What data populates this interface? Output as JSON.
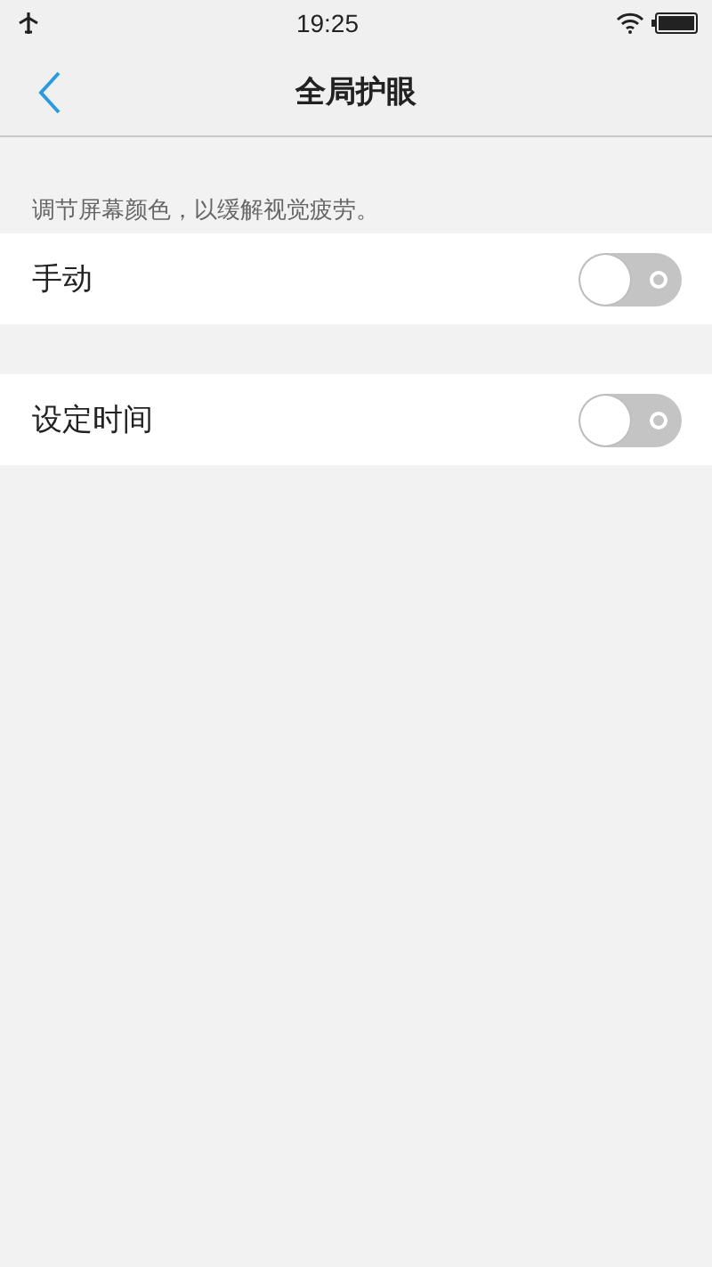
{
  "status_bar": {
    "time": "19:25"
  },
  "header": {
    "title": "全局护眼"
  },
  "description": "调节屏幕颜色，以缓解视觉疲劳。",
  "groups": [
    {
      "rows": [
        {
          "label": "手动",
          "on": false
        }
      ]
    },
    {
      "rows": [
        {
          "label": "设定时间",
          "on": false
        }
      ]
    }
  ]
}
